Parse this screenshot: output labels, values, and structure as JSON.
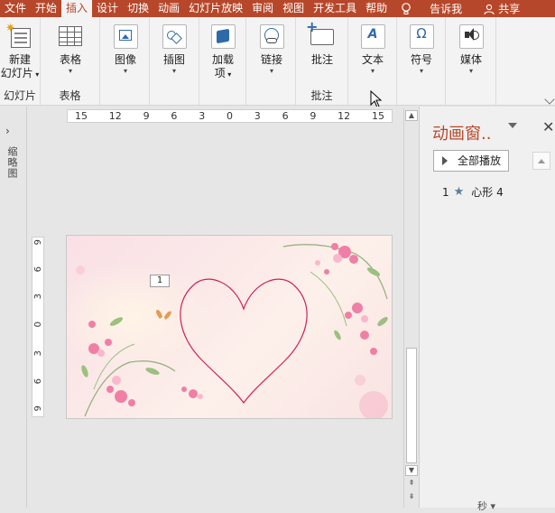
{
  "tabs": [
    {
      "id": "file",
      "label": "文件",
      "active": false
    },
    {
      "id": "home",
      "label": "开始",
      "active": false
    },
    {
      "id": "insert",
      "label": "插入",
      "active": true
    },
    {
      "id": "design",
      "label": "设计",
      "active": false
    },
    {
      "id": "transitions",
      "label": "切换",
      "active": false
    },
    {
      "id": "animations",
      "label": "动画",
      "active": false
    },
    {
      "id": "slideshow",
      "label": "幻灯片放映",
      "active": false
    },
    {
      "id": "review",
      "label": "审阅",
      "active": false
    },
    {
      "id": "view",
      "label": "视图",
      "active": false
    },
    {
      "id": "developer",
      "label": "开发工具",
      "active": false
    },
    {
      "id": "help",
      "label": "帮助",
      "active": false
    }
  ],
  "tell_me": "告诉我",
  "share": "共享",
  "ribbon": {
    "new_slide": {
      "line1": "新建",
      "line2": "幻灯片"
    },
    "table": "表格",
    "images": "图像",
    "illustrations": "插图",
    "addins": {
      "line1": "加载",
      "line2": "项"
    },
    "links": "链接",
    "comment": "批注",
    "text": "文本",
    "symbols": "符号",
    "media": "媒体",
    "groups": {
      "slides": "幻灯片",
      "tables": "表格",
      "comments": "批注"
    }
  },
  "left_rail_label": "缩略图",
  "ruler": {
    "horizontal": [
      "15",
      "12",
      "9",
      "6",
      "3",
      "0",
      "3",
      "6",
      "9",
      "12",
      "15"
    ],
    "vertical": [
      "9",
      "6",
      "3",
      "0",
      "3",
      "6",
      "9"
    ]
  },
  "slide": {
    "animation_tag": "1"
  },
  "animation_pane": {
    "title": "动画窗..",
    "play_all": "全部播放",
    "items": [
      {
        "index": "1",
        "name": "心形 4"
      }
    ],
    "footer": "秒"
  },
  "colors": {
    "accent": "#b7472a",
    "heart": "#d0205a"
  }
}
